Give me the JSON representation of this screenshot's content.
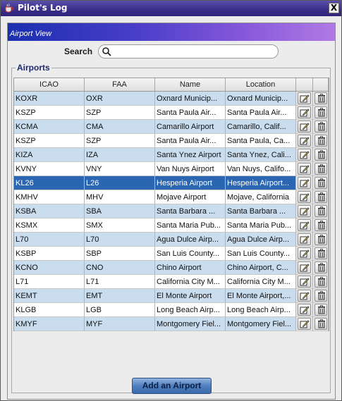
{
  "window": {
    "title": "Pilot's Log",
    "close_glyph": "X"
  },
  "view": {
    "title": "Airport View"
  },
  "search": {
    "label": "Search",
    "value": "",
    "placeholder": ""
  },
  "airports": {
    "group_label": "Airports",
    "columns": [
      "ICAO",
      "FAA",
      "Name",
      "Location"
    ],
    "selected_index": 6,
    "rows": [
      {
        "icao": "KOXR",
        "faa": "OXR",
        "name": "Oxnard Municip...",
        "location": "Oxnard Municip..."
      },
      {
        "icao": "KSZP",
        "faa": "SZP",
        "name": "Santa Paula Air...",
        "location": "Santa Paula Air..."
      },
      {
        "icao": "KCMA",
        "faa": "CMA",
        "name": "Camarillo Airport",
        "location": "Camarillo, Calif..."
      },
      {
        "icao": "KSZP",
        "faa": "SZP",
        "name": "Santa Paula Air...",
        "location": "Santa Paula, Ca..."
      },
      {
        "icao": "KIZA",
        "faa": "IZA",
        "name": "Santa Ynez Airport",
        "location": "Santa Ynez, Cali..."
      },
      {
        "icao": "KVNY",
        "faa": "VNY",
        "name": "Van Nuys Airport",
        "location": "Van Nuys, Califo..."
      },
      {
        "icao": "KL26",
        "faa": "L26",
        "name": "Hesperia Airport",
        "location": "Hesperia Airport..."
      },
      {
        "icao": "KMHV",
        "faa": "MHV",
        "name": "Mojave Airport",
        "location": "Mojave, California"
      },
      {
        "icao": "KSBA",
        "faa": "SBA",
        "name": "Santa Barbara ...",
        "location": "Santa Barbara ..."
      },
      {
        "icao": "KSMX",
        "faa": "SMX",
        "name": "Santa Maria Pub...",
        "location": "Santa Maria Pub..."
      },
      {
        "icao": "L70",
        "faa": "L70",
        "name": "Agua Dulce Airp...",
        "location": "Agua Dulce Airp..."
      },
      {
        "icao": "KSBP",
        "faa": "SBP",
        "name": "San Luis County...",
        "location": "San Luis County..."
      },
      {
        "icao": "KCNO",
        "faa": "CNO",
        "name": "Chino Airport",
        "location": "Chino Airport, C..."
      },
      {
        "icao": "L71",
        "faa": "L71",
        "name": "California City M...",
        "location": "California City M..."
      },
      {
        "icao": "KEMT",
        "faa": "EMT",
        "name": "El Monte Airport",
        "location": "El Monte Airport,..."
      },
      {
        "icao": "KLGB",
        "faa": "LGB",
        "name": "Long Beach Airp...",
        "location": "Long Beach Airp..."
      },
      {
        "icao": "KMYF",
        "faa": "MYF",
        "name": "Montgomery Fiel...",
        "location": "Montgomery Fiel..."
      }
    ],
    "row_actions": [
      "edit-icon",
      "trash-icon"
    ]
  },
  "footer": {
    "add_button_label": "Add an Airport"
  },
  "colors": {
    "row_alt": "#c9ddef",
    "row_selected": "#2a66b1",
    "title_bar": "#3b2f8d",
    "view_header": "#4a3ec9"
  }
}
